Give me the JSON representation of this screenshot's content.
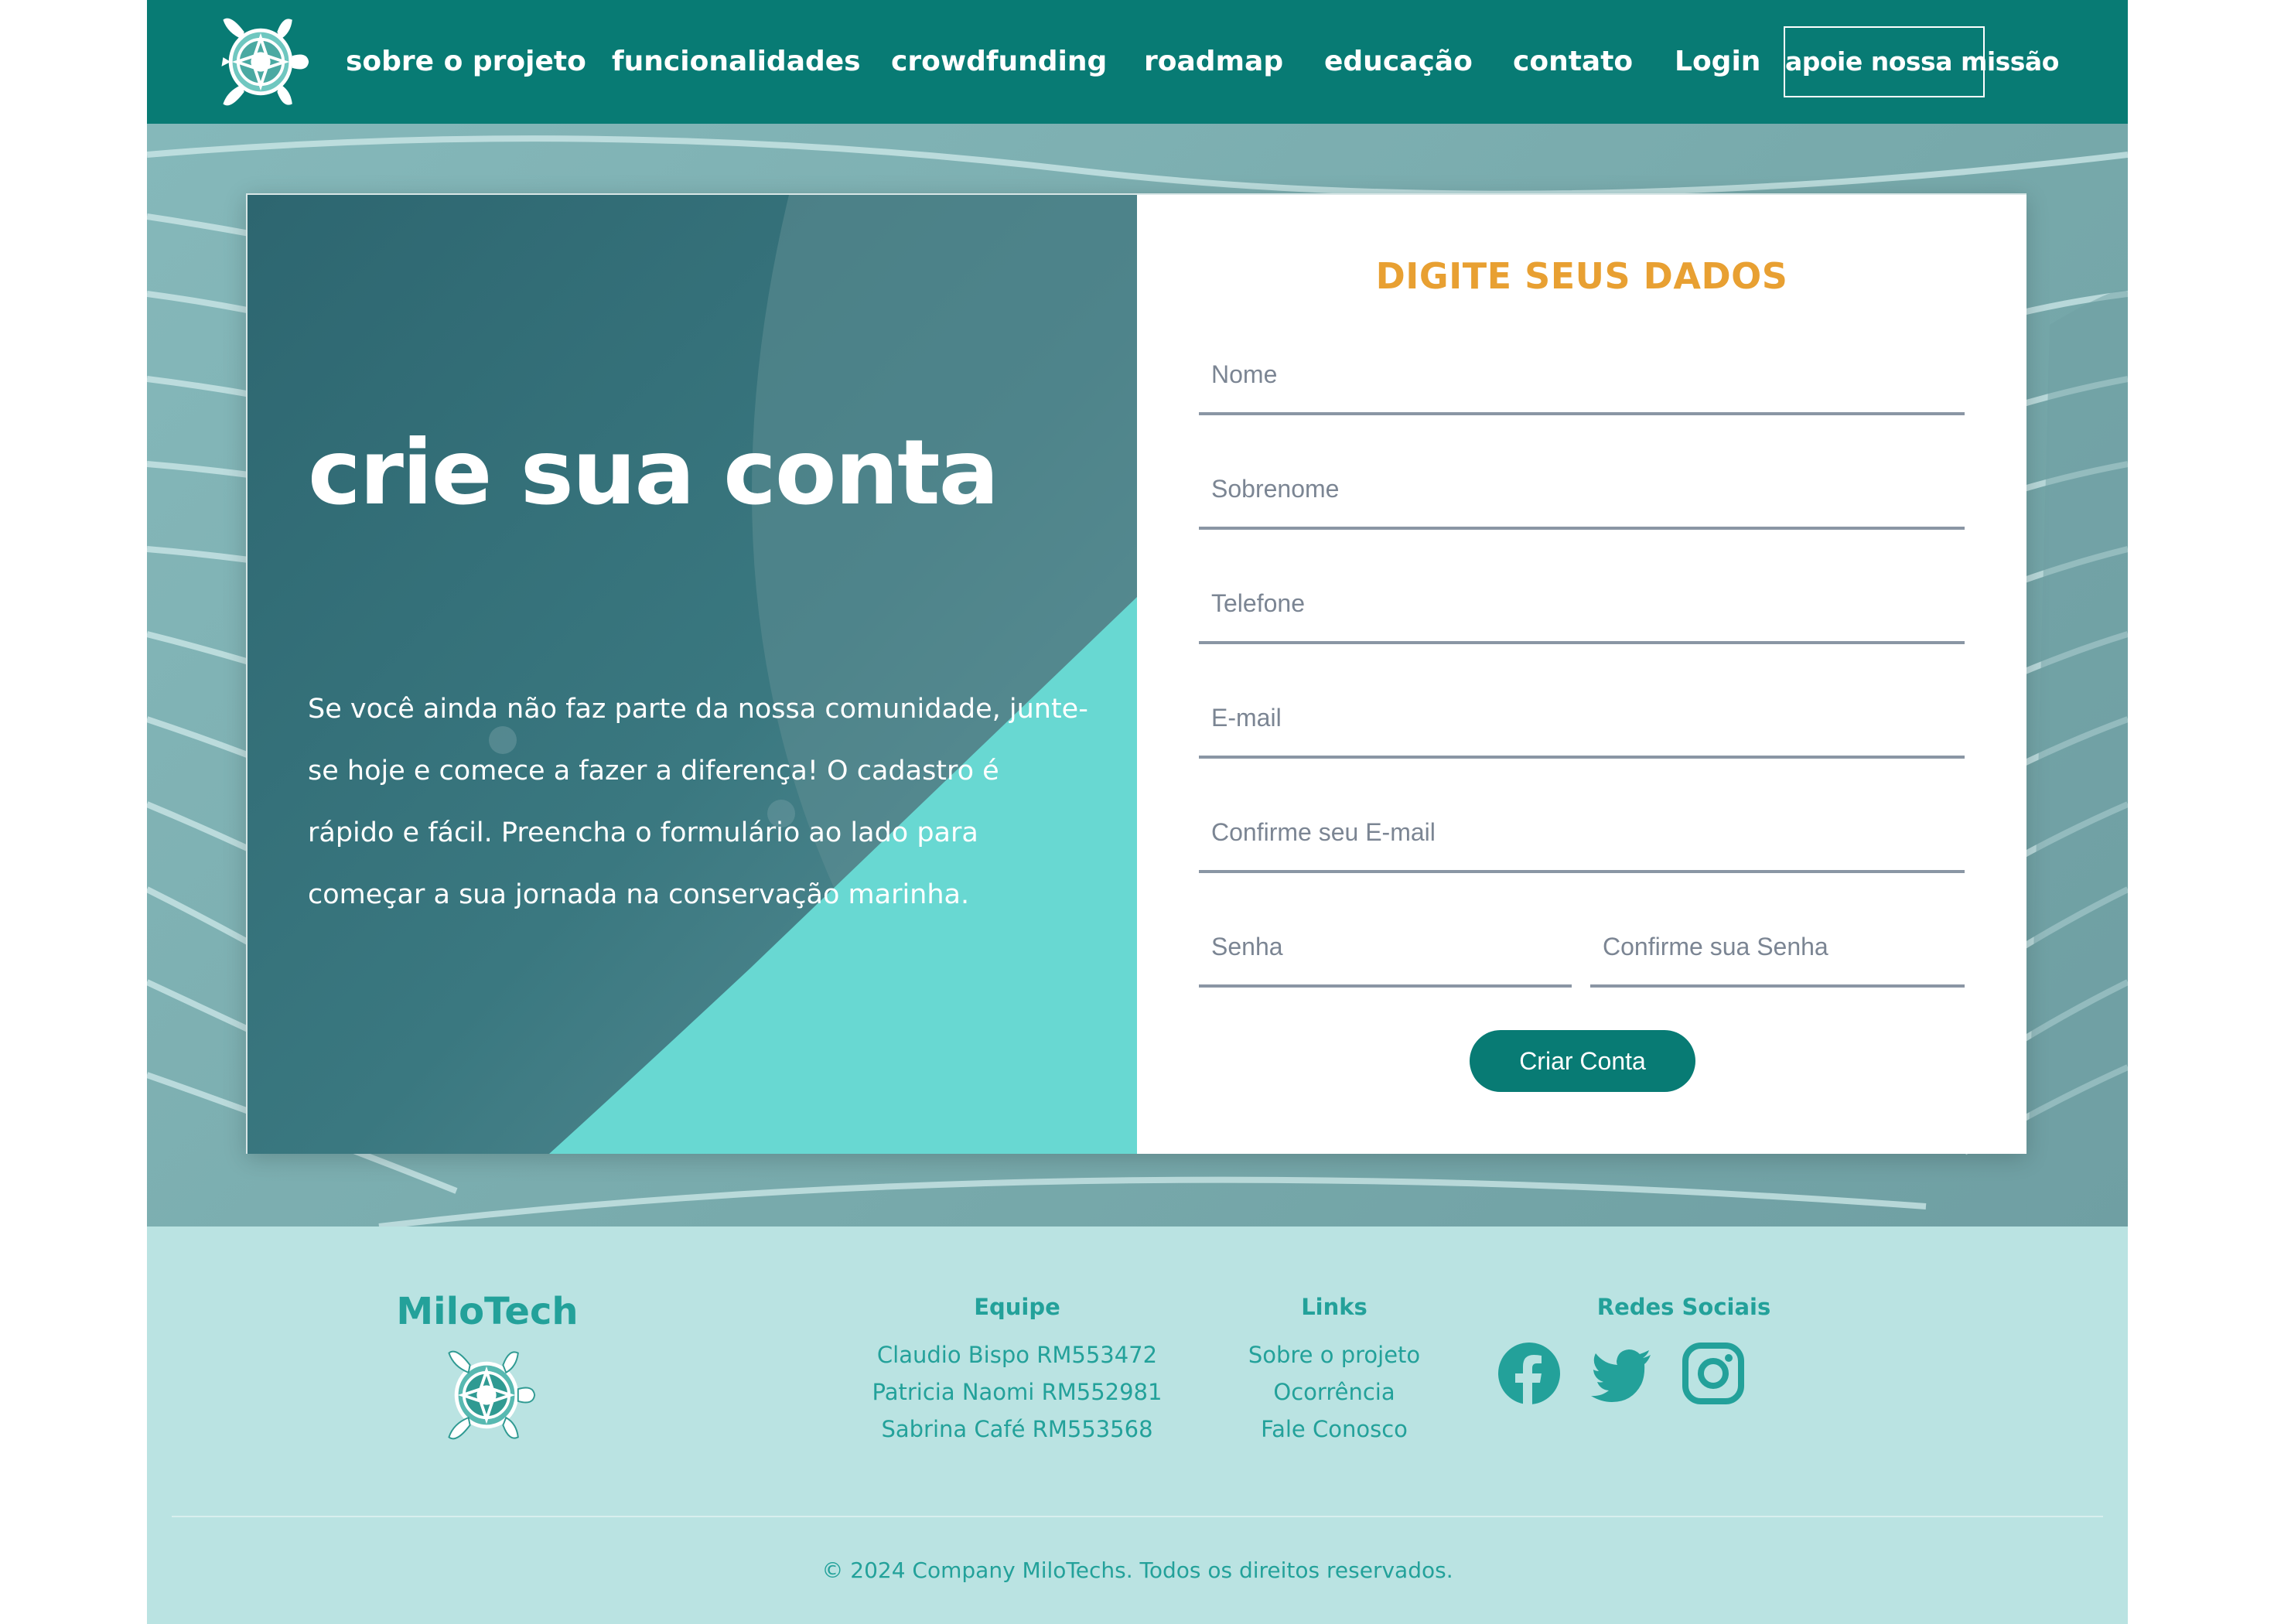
{
  "nav": {
    "links": [
      "sobre o projeto",
      "funcionalidades",
      "crowdfunding",
      "roadmap",
      "educação",
      "contato",
      "Login"
    ],
    "cta": "apoie nossa missão"
  },
  "signup": {
    "title": "crie sua conta",
    "description": "Se você ainda não faz parte da nossa comunidade, junte-se hoje e comece a fazer a diferença! O cadastro é rápido e fácil. Preencha o formulário ao lado para começar a sua jornada na conservação marinha.",
    "form_title": "DIGITE SEUS DADOS",
    "fields": {
      "nome": "Nome",
      "sobrenome": "Sobrenome",
      "telefone": "Telefone",
      "email": "E-mail",
      "confirm_email": "Confirme seu E-mail",
      "senha": "Senha",
      "confirm_senha": "Confirme sua Senha"
    },
    "submit": "Criar Conta"
  },
  "footer": {
    "brand": "MiloTech",
    "team_title": "Equipe",
    "team": [
      "Claudio Bispo RM553472",
      "Patricia Naomi RM552981",
      "Sabrina Café RM553568"
    ],
    "links_title": "Links",
    "links": [
      "Sobre o projeto",
      "Ocorrência",
      "Fale Conosco"
    ],
    "social_title": "Redes Sociais",
    "social": [
      "facebook-icon",
      "twitter-icon",
      "instagram-icon"
    ],
    "copyright": "© 2024 Company MiloTechs. Todos os direitos reservados."
  },
  "colors": {
    "nav_bg": "#087b74",
    "accent_orange": "#e8a032",
    "footer_bg": "#bae3e2",
    "footer_text": "#23a19a"
  }
}
